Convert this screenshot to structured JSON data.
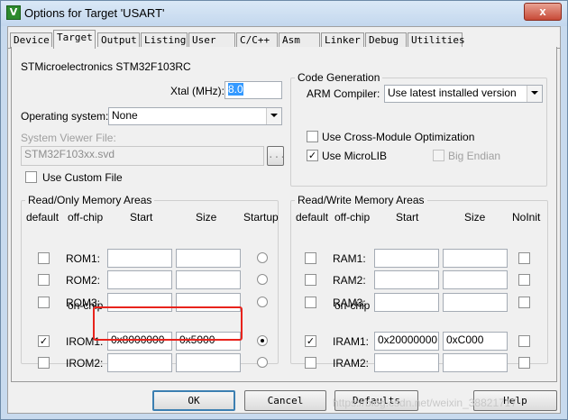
{
  "window": {
    "title": "Options for Target 'USART'",
    "app_icon": "V",
    "close_label": "x"
  },
  "tabs": [
    "Device",
    "Target",
    "Output",
    "Listing",
    "User",
    "C/C++",
    "Asm",
    "Linker",
    "Debug",
    "Utilities"
  ],
  "target": {
    "device_name": "STMicroelectronics STM32F103RC",
    "xtal_label": "Xtal (MHz):",
    "xtal_value": "8.0",
    "os_label": "Operating system:",
    "os_value": "None",
    "svd_label": "System Viewer File:",
    "svd_value": "STM32F103xx.svd",
    "svd_browse": "...",
    "use_custom_file": "Use Custom File"
  },
  "code_generation": {
    "title": "Code Generation",
    "arm_compiler_label": "ARM Compiler:",
    "arm_compiler_value": "Use latest installed version",
    "cross_module": "Use Cross-Module Optimization",
    "cross_module_checked": false,
    "microlib": "Use MicroLIB",
    "microlib_checked": true,
    "big_endian": "Big Endian",
    "big_endian_checked": false
  },
  "rom": {
    "title": "Read/Only Memory Areas",
    "headers": {
      "default": "default",
      "offchip": "off-chip",
      "start": "Start",
      "size": "Size",
      "last": "Startup"
    },
    "onchip_label": "on-chip",
    "rows": [
      {
        "name": "ROM1:",
        "default": false,
        "start": "",
        "size": "",
        "selected": false
      },
      {
        "name": "ROM2:",
        "default": false,
        "start": "",
        "size": "",
        "selected": false
      },
      {
        "name": "ROM3:",
        "default": false,
        "start": "",
        "size": "",
        "selected": false
      },
      {
        "name": "IROM1:",
        "default": true,
        "start": "0x8000000",
        "size": "0x5000",
        "selected": true
      },
      {
        "name": "IROM2:",
        "default": false,
        "start": "",
        "size": "",
        "selected": false
      }
    ]
  },
  "ram": {
    "title": "Read/Write Memory Areas",
    "headers": {
      "default": "default",
      "offchip": "off-chip",
      "start": "Start",
      "size": "Size",
      "last": "NoInit"
    },
    "onchip_label": "on-chip",
    "rows": [
      {
        "name": "RAM1:",
        "default": false,
        "start": "",
        "size": "",
        "noinit": false
      },
      {
        "name": "RAM2:",
        "default": false,
        "start": "",
        "size": "",
        "noinit": false
      },
      {
        "name": "RAM3:",
        "default": false,
        "start": "",
        "size": "",
        "noinit": false
      },
      {
        "name": "IRAM1:",
        "default": true,
        "start": "0x20000000",
        "size": "0xC000",
        "noinit": false
      },
      {
        "name": "IRAM2:",
        "default": false,
        "start": "",
        "size": "",
        "noinit": false
      }
    ]
  },
  "buttons": {
    "ok": "OK",
    "cancel": "Cancel",
    "defaults": "Defaults",
    "help": "Help"
  },
  "watermark": "https://blog.csdn.net/weixin_38821717",
  "check_mark": "✓"
}
